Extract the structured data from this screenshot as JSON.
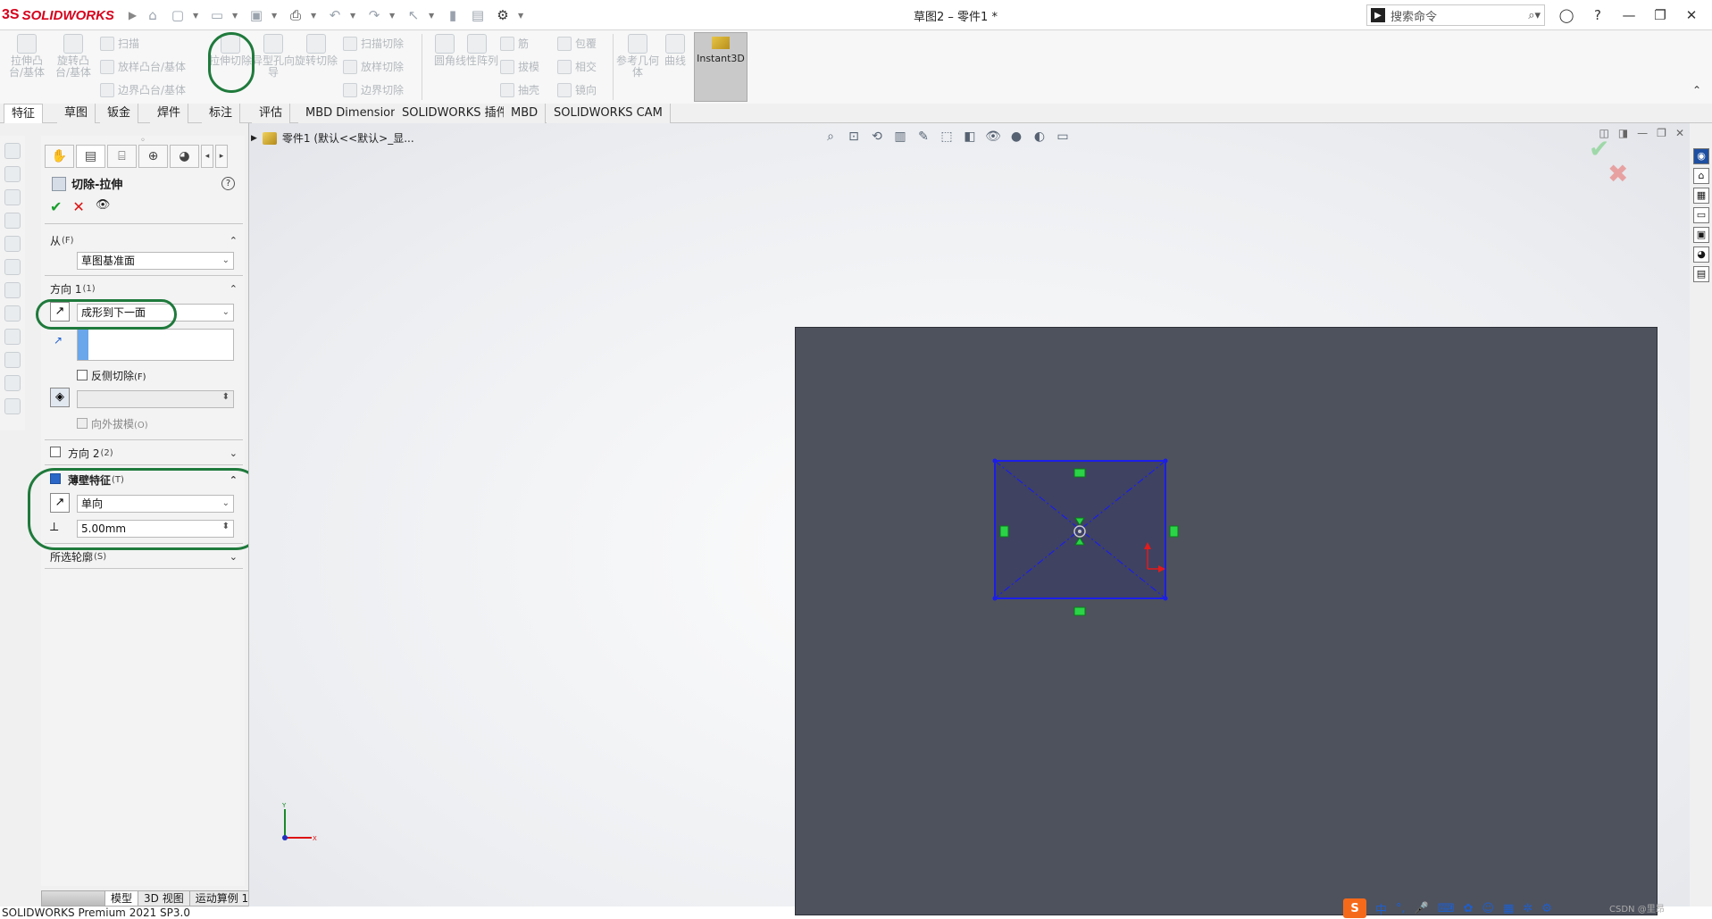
{
  "app": {
    "brand": "SOLIDWORKS",
    "doc_title": "草图2 – 零件1 *",
    "search_placeholder": "搜索命令",
    "status_text": "SOLIDWORKS Premium 2021 SP3.0"
  },
  "command_manager": {
    "big": [
      {
        "label": "拉伸凸台/基体",
        "disabled": true
      },
      {
        "label": "旋转凸台/基体",
        "disabled": true
      },
      {
        "label": "拉伸切除",
        "disabled": true
      },
      {
        "label": "异型孔向导",
        "disabled": true
      },
      {
        "label": "旋转切除",
        "disabled": true
      },
      {
        "label": "圆角",
        "disabled": true
      },
      {
        "label": "线性阵列",
        "disabled": true
      },
      {
        "label": "参考几何体",
        "disabled": true
      },
      {
        "label": "曲线",
        "disabled": true
      }
    ],
    "small": {
      "sweep": "扫描",
      "loft": "放样凸台/基体",
      "boundary": "边界凸台/基体",
      "sweep_cut": "扫描切除",
      "loft_cut": "放样切除",
      "boundary_cut": "边界切除",
      "rib": "筋",
      "draft": "拔模",
      "shell": "抽壳",
      "wrap": "包覆",
      "intersect": "相交",
      "mirror": "镜向"
    },
    "instant3d": "Instant3D"
  },
  "tabs": [
    "特征",
    "草图",
    "钣金",
    "焊件",
    "标注",
    "评估",
    "MBD Dimensions",
    "SOLIDWORKS 插件",
    "MBD",
    "SOLIDWORKS CAM"
  ],
  "property_manager": {
    "title": "切除-拉伸",
    "help": "?",
    "from": {
      "header": "从",
      "hotkey": "(F)",
      "value": "草图基准面"
    },
    "direction1": {
      "header": "方向 1",
      "hotkey": "(1)",
      "end_condition": "成形到下一面",
      "flip_cut": "反侧切除",
      "flip_cut_hotkey": "(F)",
      "draft_outward": "向外拔模",
      "draft_outward_hotkey": "(O)"
    },
    "direction2": {
      "header": "方向 2",
      "hotkey": "(2)",
      "checked": false
    },
    "thin_feature": {
      "header": "薄壁特征",
      "hotkey": "(T)",
      "checked": true,
      "type": "单向",
      "thickness": "5.00mm"
    },
    "selected_contours": {
      "header": "所选轮廓",
      "hotkey": "(S)"
    }
  },
  "feature_tree": {
    "path": "零件1  (默认<<默认>_显..."
  },
  "bottom_tabs": [
    "模型",
    "3D 视图",
    "运动算例 1"
  ],
  "ime": {
    "label": "中",
    "punct": "°,"
  },
  "watermark": "CSDN @里昂",
  "viewport": {
    "triad_x": "X",
    "triad_y": "Y"
  }
}
